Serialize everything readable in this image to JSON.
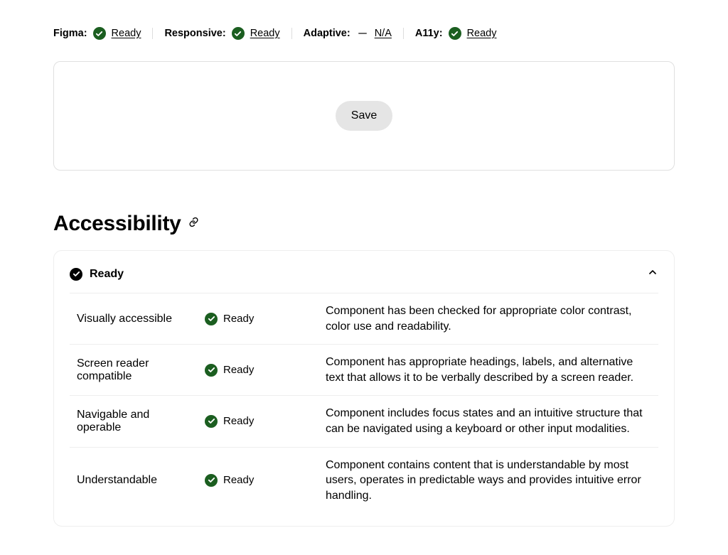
{
  "status_bar": {
    "figma": {
      "label": "Figma:",
      "value": "Ready",
      "icon": "check"
    },
    "responsive": {
      "label": "Responsive:",
      "value": "Ready",
      "icon": "check"
    },
    "adaptive": {
      "label": "Adaptive:",
      "value": "N/A",
      "icon": "dash"
    },
    "a11y": {
      "label": "A11y:",
      "value": "Ready",
      "icon": "check"
    }
  },
  "card": {
    "save_label": "Save"
  },
  "section": {
    "heading": "Accessibility"
  },
  "accordion": {
    "summary": "Ready",
    "rows": [
      {
        "name": "Visually accessible",
        "status": "Ready",
        "desc": "Component has been checked for appropriate color contrast, color use and readability."
      },
      {
        "name": "Screen reader compatible",
        "status": "Ready",
        "desc": "Component has appropriate headings, labels, and alternative text that allows it to be verbally described by a screen reader."
      },
      {
        "name": "Navigable and operable",
        "status": "Ready",
        "desc": "Component includes focus states and an intuitive structure that can be navigated using a keyboard or other input modalities."
      },
      {
        "name": "Understandable",
        "status": "Ready",
        "desc": "Component contains content that is understandable by most users, operates in predictable ways and provides intuitive error handling."
      }
    ]
  }
}
